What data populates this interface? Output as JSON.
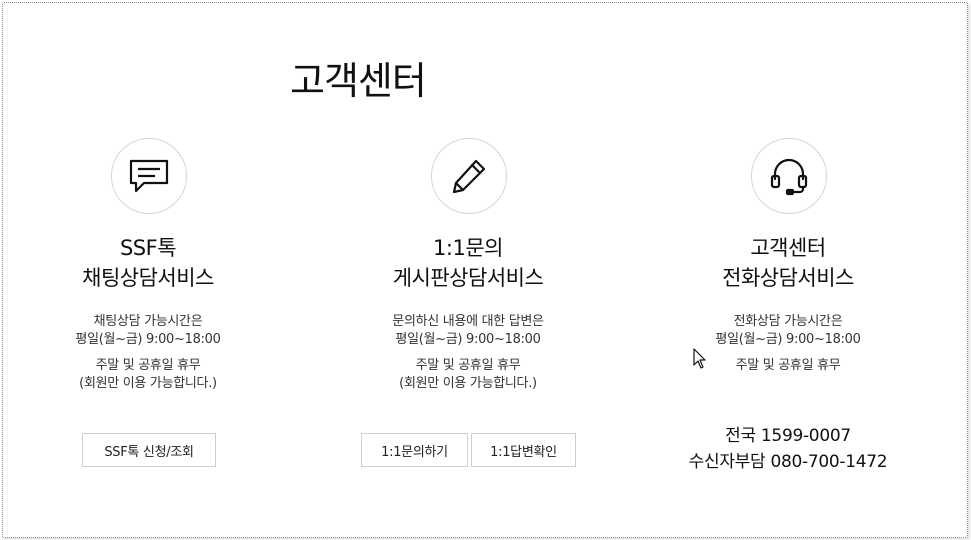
{
  "page": {
    "title": "고객센터"
  },
  "sections": [
    {
      "icon": "chat-bubble-icon",
      "heading_line1": "SSF톡",
      "heading_line2": "채팅상담서비스",
      "desc": [
        "채팅상담 가능시간은",
        "평일(월~금) 9:00~18:00"
      ],
      "note": [
        "주말 및 공휴일 휴무",
        "(회원만 이용 가능합니다.)"
      ],
      "buttons": [
        "SSF톡 신청/조회"
      ]
    },
    {
      "icon": "pencil-icon",
      "heading_line1": "1:1문의",
      "heading_line2": "게시판상담서비스",
      "desc": [
        "문의하신 내용에 대한 답변은",
        "평일(월~금) 9:00~18:00"
      ],
      "note": [
        "주말 및 공휴일 휴무",
        "(회원만 이용 가능합니다.)"
      ],
      "buttons": [
        "1:1문의하기",
        "1:1답변확인"
      ]
    },
    {
      "icon": "headset-icon",
      "heading_line1": "고객센터",
      "heading_line2": "전화상담서비스",
      "desc": [
        "전화상담 가능시간은",
        "평일(월~금) 9:00~18:00"
      ],
      "note": [
        "주말 및 공휴일 휴무"
      ],
      "phones": [
        "전국 1599-0007",
        "수신자부담 080-700-1472"
      ]
    }
  ]
}
